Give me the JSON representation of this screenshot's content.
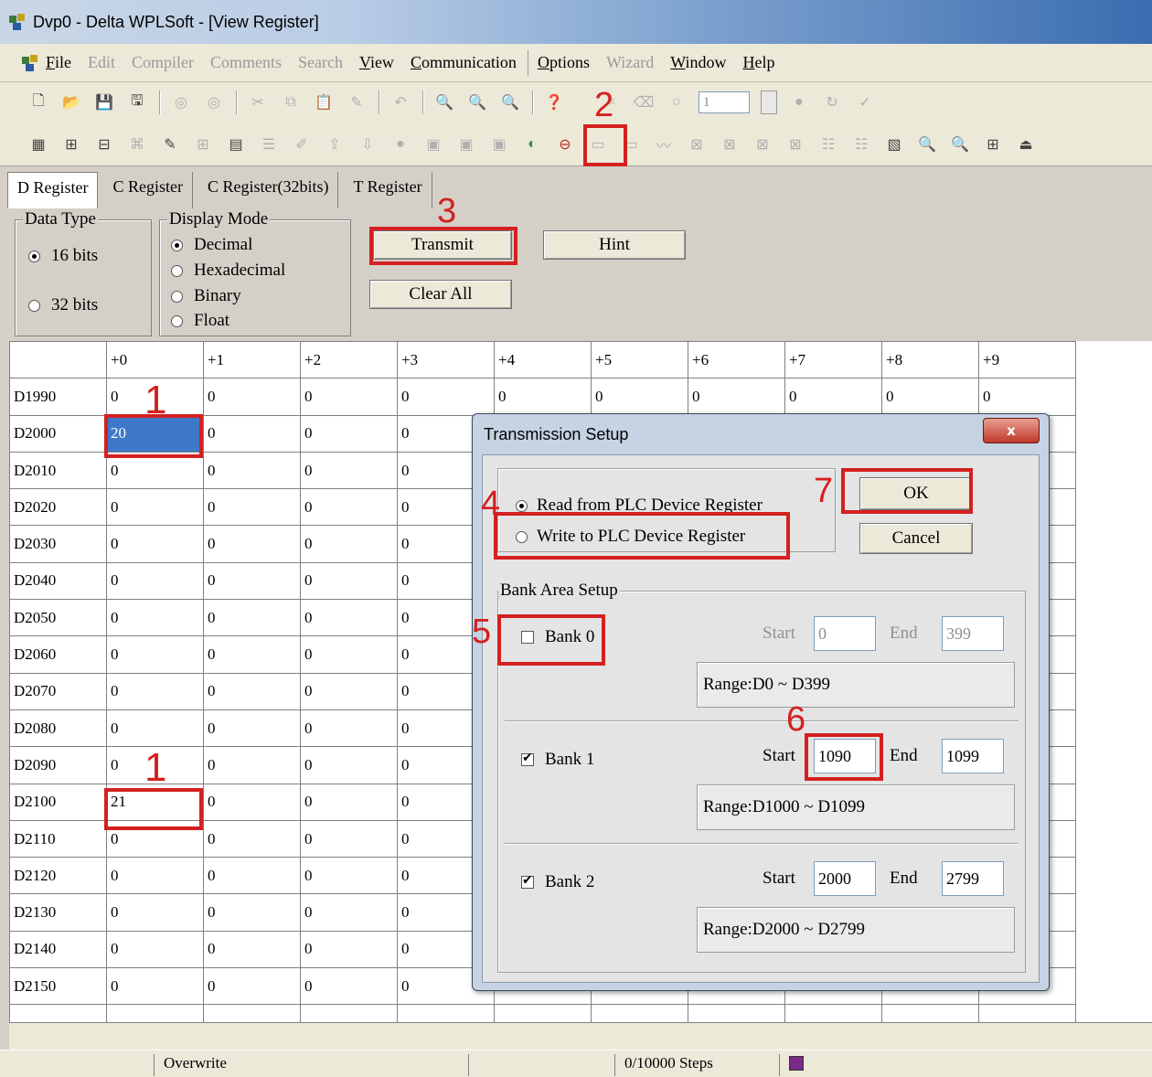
{
  "window": {
    "title": "Dvp0 - Delta WPLSoft - [View Register]"
  },
  "menu": [
    {
      "label": "File",
      "disabled": false
    },
    {
      "label": "Edit",
      "disabled": true
    },
    {
      "label": "Compiler",
      "disabled": true
    },
    {
      "label": "Comments",
      "disabled": true
    },
    {
      "label": "Search",
      "disabled": true
    },
    {
      "label": "View",
      "disabled": false
    },
    {
      "label": "Communication",
      "disabled": false
    },
    {
      "label": "Options",
      "disabled": false
    },
    {
      "label": "Wizard",
      "disabled": true
    },
    {
      "label": "Window",
      "disabled": false
    },
    {
      "label": "Help",
      "disabled": false
    }
  ],
  "toolbar": {
    "step_value": "1"
  },
  "tabs": [
    {
      "label": "D Register",
      "active": true
    },
    {
      "label": "C Register",
      "active": false
    },
    {
      "label": "C Register(32bits)",
      "active": false
    },
    {
      "label": "T Register",
      "active": false
    }
  ],
  "data_type": {
    "legend": "Data Type",
    "opt16": "16 bits",
    "opt32": "32 bits",
    "selected": "16 bits"
  },
  "display_mode": {
    "legend": "Display Mode",
    "options": [
      "Decimal",
      "Hexadecimal",
      "Binary",
      "Float"
    ],
    "selected": "Decimal"
  },
  "buttons": {
    "transmit": "Transmit",
    "hint": "Hint",
    "clear_all": "Clear All"
  },
  "grid": {
    "columns": [
      "",
      "+0",
      "+1",
      "+2",
      "+3",
      "+4",
      "+5",
      "+6",
      "+7",
      "+8",
      "+9"
    ],
    "rows": [
      {
        "label": "D1990",
        "values": [
          "0",
          "0",
          "0",
          "0",
          "0",
          "0",
          "0",
          "0",
          "0",
          "0"
        ]
      },
      {
        "label": "D2000",
        "values": [
          "20",
          "0",
          "0",
          "0"
        ]
      },
      {
        "label": "D2010",
        "values": [
          "0",
          "0",
          "0",
          "0"
        ]
      },
      {
        "label": "D2020",
        "values": [
          "0",
          "0",
          "0",
          "0"
        ]
      },
      {
        "label": "D2030",
        "values": [
          "0",
          "0",
          "0",
          "0"
        ]
      },
      {
        "label": "D2040",
        "values": [
          "0",
          "0",
          "0",
          "0"
        ]
      },
      {
        "label": "D2050",
        "values": [
          "0",
          "0",
          "0",
          "0"
        ]
      },
      {
        "label": "D2060",
        "values": [
          "0",
          "0",
          "0",
          "0"
        ]
      },
      {
        "label": "D2070",
        "values": [
          "0",
          "0",
          "0",
          "0"
        ]
      },
      {
        "label": "D2080",
        "values": [
          "0",
          "0",
          "0",
          "0"
        ]
      },
      {
        "label": "D2090",
        "values": [
          "0",
          "0",
          "0",
          "0"
        ]
      },
      {
        "label": "D2100",
        "values": [
          "21",
          "0",
          "0",
          "0"
        ]
      },
      {
        "label": "D2110",
        "values": [
          "0",
          "0",
          "0",
          "0"
        ]
      },
      {
        "label": "D2120",
        "values": [
          "0",
          "0",
          "0",
          "0"
        ]
      },
      {
        "label": "D2130",
        "values": [
          "0",
          "0",
          "0",
          "0"
        ]
      },
      {
        "label": "D2140",
        "values": [
          "0",
          "0",
          "0",
          "0"
        ]
      },
      {
        "label": "D2150",
        "values": [
          "0",
          "0",
          "0",
          "0"
        ]
      }
    ]
  },
  "dialog": {
    "title": "Transmission Setup",
    "close": "x",
    "read_option": "Read from PLC Device Register",
    "write_option": "Write to PLC Device Register",
    "ok": "OK",
    "cancel": "Cancel",
    "bank_legend": "Bank Area Setup",
    "start_label": "Start",
    "end_label": "End",
    "banks": [
      {
        "label": "Bank 0",
        "checked": false,
        "start": "0",
        "end": "399",
        "range": "Range:D0 ~ D399"
      },
      {
        "label": "Bank 1",
        "checked": true,
        "start": "1090",
        "end": "1099",
        "range": "Range:D1000 ~ D1099"
      },
      {
        "label": "Bank 2",
        "checked": true,
        "start": "2000",
        "end": "2799",
        "range": "Range:D2000 ~ D2799"
      }
    ]
  },
  "annotations": {
    "n1a": "1",
    "n1b": "1",
    "n2": "2",
    "n3": "3",
    "n4": "4",
    "n5": "5",
    "n6": "6",
    "n7": "7"
  },
  "status": {
    "mode": "Overwrite",
    "steps": "0/10000 Steps"
  },
  "colors": {
    "annotation": "#d42020",
    "selection": "#3e78c8"
  }
}
